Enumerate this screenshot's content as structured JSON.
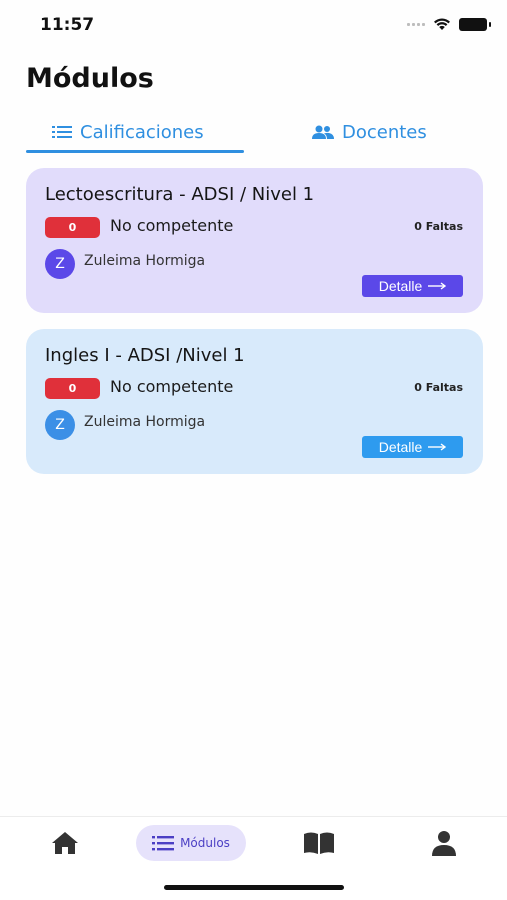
{
  "status_bar": {
    "time": "11:57"
  },
  "page": {
    "title": "Módulos"
  },
  "tabs": [
    {
      "label": "Calificaciones",
      "icon": "list-icon",
      "active": true
    },
    {
      "label": "Docentes",
      "icon": "users-icon",
      "active": false
    }
  ],
  "modules": [
    {
      "title": "Lectoescritura - ADSI /  Nivel 1",
      "grade": "0",
      "status": "No competente",
      "absences": "0 Faltas",
      "teacher_initial": "Z",
      "teacher_name": "Zuleima Hormiga",
      "detail_label": "Detalle",
      "color": "#e1dcfb"
    },
    {
      "title": "Ingles I - ADSI  /Nivel 1",
      "grade": "0",
      "status": "No competente",
      "absences": "0 Faltas",
      "teacher_initial": "Z",
      "teacher_name": "Zuleima Hormiga",
      "detail_label": "Detalle",
      "color": "#d8eafb"
    }
  ],
  "bottom_nav": {
    "items": [
      {
        "icon": "home-icon"
      },
      {
        "icon": "list-icon",
        "label": "Módulos",
        "active": true
      },
      {
        "icon": "book-icon"
      },
      {
        "icon": "user-icon"
      }
    ]
  },
  "colors": {
    "accent_blue": "#2f8fe0",
    "accent_purple": "#5b48e8",
    "badge_red": "#e0303a"
  }
}
